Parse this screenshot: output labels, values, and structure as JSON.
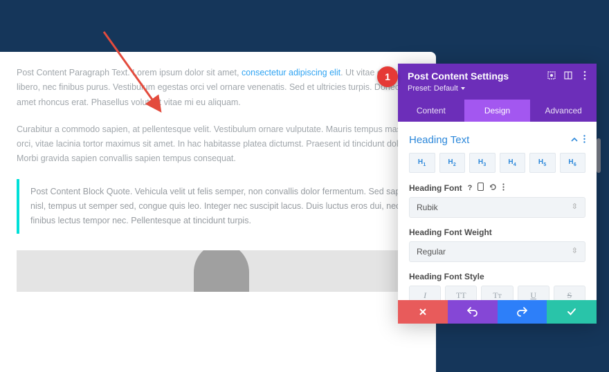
{
  "annotation": {
    "number": "1"
  },
  "content": {
    "para1_pre": "Post Content Paragraph Text. Lorem ipsum dolor sit amet, ",
    "para1_link": "consectetur adipiscing elit",
    "para1_post": ". Ut vitae congue libero, nec finibus purus. Vestibulum egestas orci vel ornare venenatis. Sed et ultricies turpis. Donec sit amet rhoncus erat. Phasellus volutpat vitae mi eu aliquam.",
    "para2": "Curabitur a commodo sapien, at pellentesque velit. Vestibulum ornare vulputate. Mauris tempus massa orci, vitae lacinia tortor maximus sit amet. In hac habitasse platea dictumst. Praesent id tincidunt dolor. Morbi gravida sapien convallis sapien tempus consequat.",
    "blockquote": "Post Content Block Quote. Vehicula velit ut felis semper, non convallis dolor fermentum. Sed sapien nisl, tempus ut semper sed, congue quis leo. Integer nec suscipit lacus. Duis luctus eros dui, nec finibus lectus tempor nec. Pellentesque at tincidunt turpis."
  },
  "panel": {
    "title": "Post Content Settings",
    "preset": "Preset: Default",
    "tabs": {
      "content": "Content",
      "design": "Design",
      "advanced": "Advanced"
    },
    "section_title": "Heading Text",
    "heading_levels": [
      "H1",
      "H2",
      "H3",
      "H4",
      "H5",
      "H6"
    ],
    "font_label": "Heading Font",
    "font_value": "Rubik",
    "weight_label": "Heading Font Weight",
    "weight_value": "Regular",
    "style_label": "Heading Font Style",
    "style_buttons": {
      "italic": "I",
      "uppercase": "TT",
      "smallcaps": "Tᴛ",
      "underline": "U",
      "strike": "S"
    }
  }
}
